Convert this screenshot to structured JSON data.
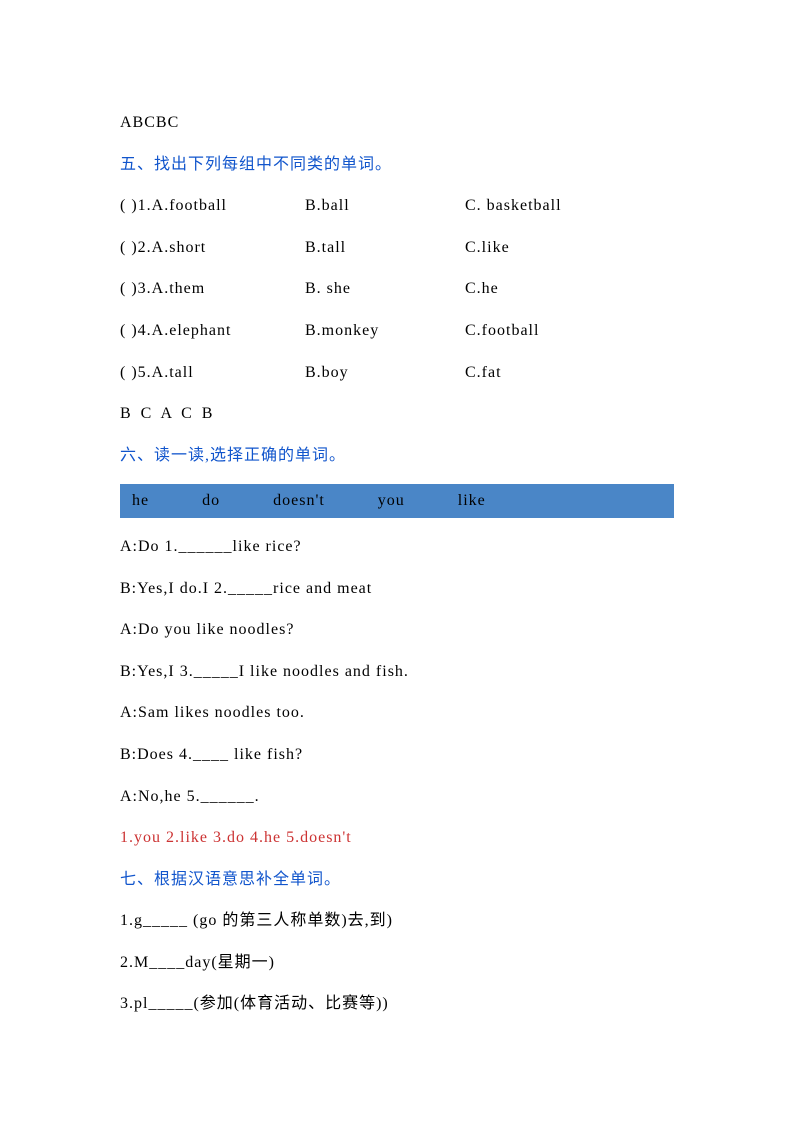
{
  "header_answer": "ABCBC",
  "section5_title": "五、找出下列每组中不同类的单词。",
  "section5_questions": [
    {
      "num": "( )1.A.football",
      "b": "B.ball",
      "c": "C. basketball"
    },
    {
      "num": "( )2.A.short",
      "b": "B.tall",
      "c": "C.like"
    },
    {
      "num": "( )3.A.them",
      "b": "B. she",
      "c": "C.he"
    },
    {
      "num": "( )4.A.elephant",
      "b": "B.monkey",
      "c": "C.football"
    },
    {
      "num": "( )5.A.tall",
      "b": "B.boy",
      "c": "C.fat"
    }
  ],
  "section5_answer": "B C A C B",
  "section6_title": "六、读一读,选择正确的单词。",
  "word_bank": [
    "he",
    "do",
    "doesn't",
    "you",
    "like"
  ],
  "section6_lines": [
    "A:Do  1.______like rice?",
    "B:Yes,I do.I 2._____rice and meat",
    "A:Do you like noodles?",
    "B:Yes,I 3._____I like noodles and fish.",
    "A:Sam likes noodles too.",
    "B:Does 4.____ like fish?",
    "A:No,he 5.______."
  ],
  "section6_answer": "1.you  2.like  3.do 4.he  5.doesn't",
  "section7_title": "七、根据汉语意思补全单词。",
  "section7_items": [
    "1.g_____ (go 的第三人称单数)去,到)",
    "2.M____day(星期一)",
    "3.pl_____(参加(体育活动、比赛等))"
  ]
}
